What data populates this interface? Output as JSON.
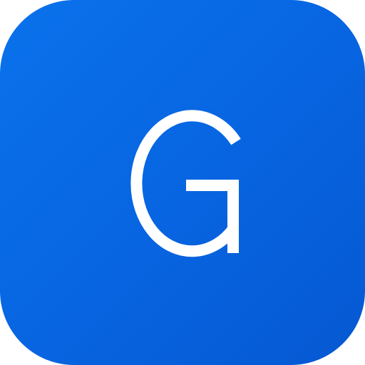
{
  "icon": {
    "name": "app-icon",
    "letter": "G",
    "background_color": "#0866E2",
    "letter_color": "#FFFFFF"
  }
}
